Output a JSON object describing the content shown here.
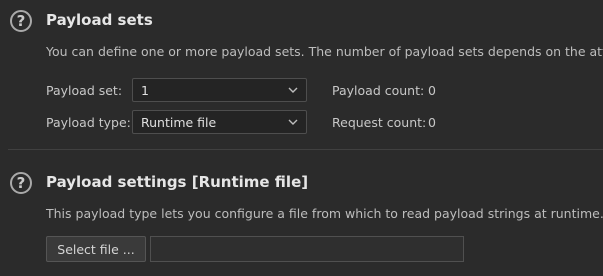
{
  "payload_sets": {
    "title": "Payload sets",
    "description": "You can define one or more payload sets. The number of payload sets depends on the attac",
    "payload_set_label": "Payload set:",
    "payload_set_value": "1",
    "payload_type_label": "Payload type:",
    "payload_type_value": "Runtime file",
    "payload_count_label": "Payload count:",
    "payload_count_value": "0",
    "request_count_label": "Request count:",
    "request_count_value": "0"
  },
  "payload_settings": {
    "title": "Payload settings [Runtime file]",
    "description": "This payload type lets you configure a file from which to read payload strings at runtime.",
    "select_file_label": "Select file ...",
    "file_path_value": ""
  },
  "icons": {
    "help": "help-icon",
    "dropdown": "chevron-down-icon"
  },
  "colors": {
    "background": "#2b2b2b",
    "field_background": "#242424",
    "border": "#4e4e4e"
  }
}
